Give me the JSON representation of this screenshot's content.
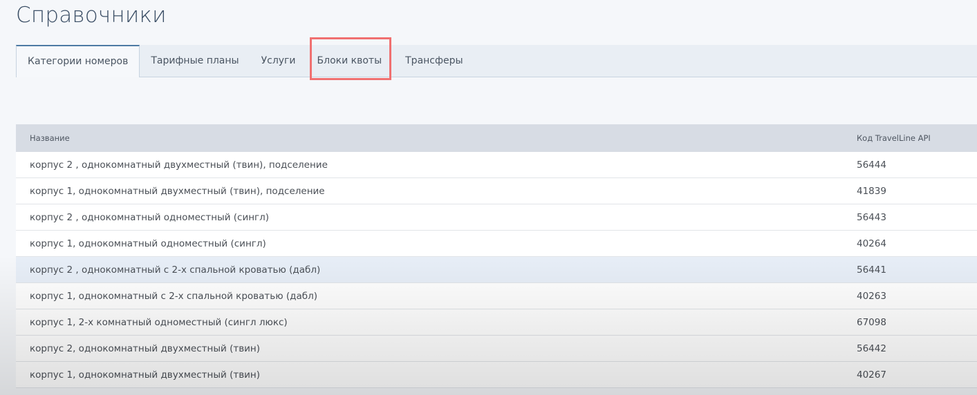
{
  "page_title": "Справочники",
  "tabs": [
    {
      "label": "Категории номеров",
      "active": true
    },
    {
      "label": "Тарифные планы"
    },
    {
      "label": "Услуги"
    },
    {
      "label": "Блоки квоты",
      "highlighted": true
    },
    {
      "label": "Трансферы"
    }
  ],
  "table": {
    "headers": {
      "name": "Название",
      "code": "Код TravelLine API"
    },
    "rows": [
      {
        "name": "корпус 2 , однокомнатный двухместный (твин), подселение",
        "code": "56444"
      },
      {
        "name": "корпус 1, однокомнатный двухместный (твин), подселение",
        "code": "41839"
      },
      {
        "name": "корпус 2 , однокомнатный одноместный (сингл)",
        "code": "56443"
      },
      {
        "name": "корпус 1, однокомнатный одноместный (сингл)",
        "code": "40264"
      },
      {
        "name": "корпус 2 , однокомнатный с 2-х спальной кроватью (дабл)",
        "code": "56441"
      },
      {
        "name": "корпус 1, однокомнатный с 2-х спальной кроватью (дабл)",
        "code": "40263"
      },
      {
        "name": "корпус 1, 2-х комнатный одноместный (сингл люкс)",
        "code": "67098"
      },
      {
        "name": "корпус 2, однокомнатный двухместный (твин)",
        "code": "56442"
      },
      {
        "name": "корпус 1, однокомнатный двухместный (твин)",
        "code": "40267"
      }
    ]
  },
  "colors": {
    "highlight": "#f07070",
    "active_tab_border": "#4d7aa3"
  }
}
